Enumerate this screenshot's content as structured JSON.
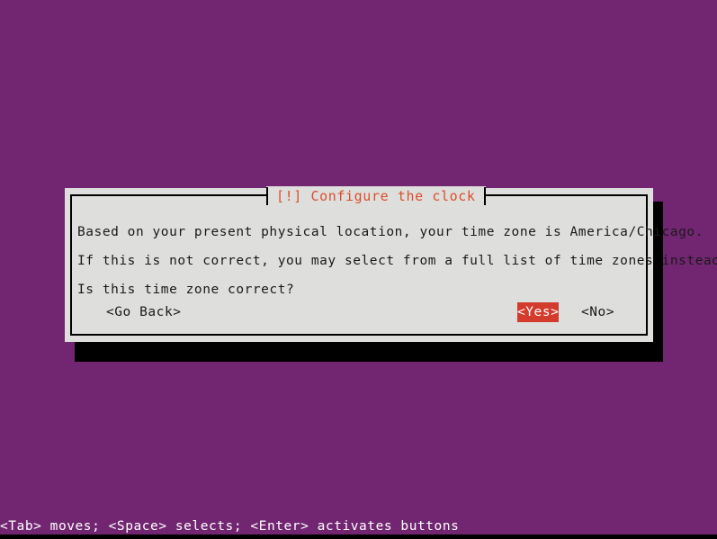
{
  "screen": {
    "background_color": "#722672",
    "bottom_strip_color": "#000000"
  },
  "dialog": {
    "title": "[!] Configure the clock",
    "title_color": "#d94f2b",
    "background_color": "#dededd",
    "border_color": "#000000",
    "shadow_color": "#000000",
    "lines": [
      "Based on your present physical location, your time zone is America/Chicago.",
      "If this is not correct, you may select from a full list of time zones instead.",
      "Is this time zone correct?"
    ],
    "buttons": {
      "go_back": "<Go Back>",
      "yes": "<Yes>",
      "no": "<No>",
      "selected": "yes",
      "selected_bg": "#d33c2c",
      "selected_fg": "#ffffff"
    }
  },
  "status_bar": {
    "text": "<Tab> moves; <Space> selects; <Enter> activates buttons",
    "color": "#ffffff"
  }
}
